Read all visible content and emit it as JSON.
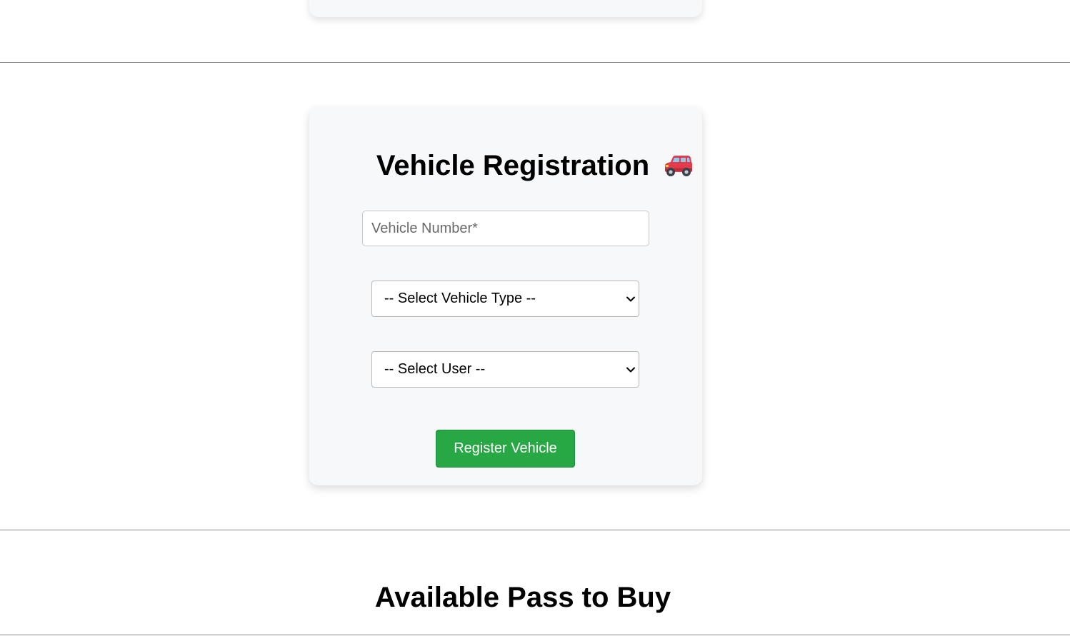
{
  "vehicle_registration": {
    "title": "Vehicle Registration",
    "title_icon": "car-icon",
    "vehicle_number_placeholder": "Vehicle Number*",
    "vehicle_number_value": "",
    "vehicle_type_select": {
      "selected": "-- Select Vehicle Type --"
    },
    "user_select": {
      "selected": "-- Select User --"
    },
    "register_button_label": "Register Vehicle",
    "colors": {
      "card_background": "#f7f8f9",
      "button_background": "#28a745",
      "button_text": "#ffffff"
    }
  },
  "available_pass_section": {
    "title": "Available Pass to Buy"
  }
}
